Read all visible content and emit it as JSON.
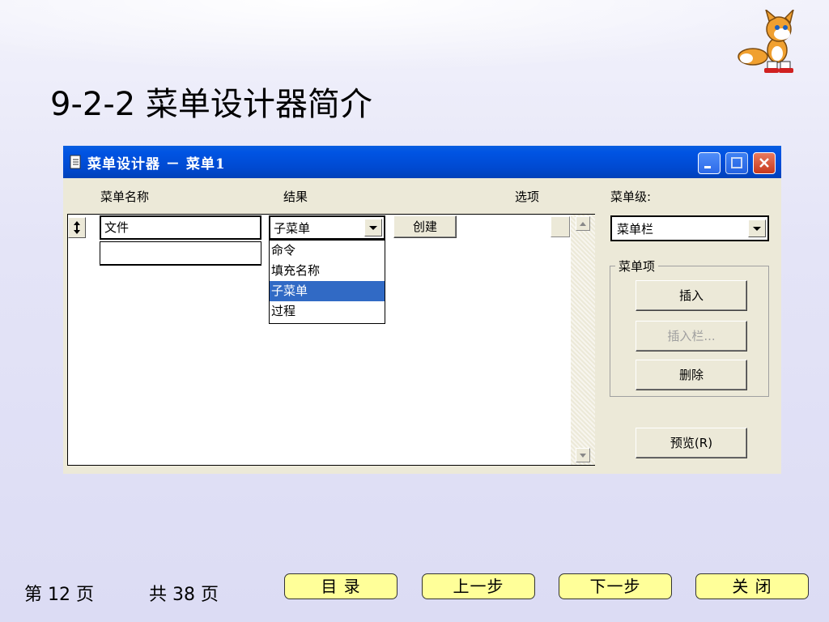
{
  "slide": {
    "title": "9-2-2 菜单设计器简介"
  },
  "dialog": {
    "title": "菜单设计器 － 菜单1",
    "columns": {
      "name": "菜单名称",
      "result": "结果",
      "options": "选项",
      "level": "菜单级:"
    },
    "rows": [
      {
        "name": "文件"
      },
      {
        "name": ""
      }
    ],
    "result_combo": {
      "value": "子菜单"
    },
    "result_options": [
      "命令",
      "填充名称",
      "子菜单",
      "过程"
    ],
    "create_button": "创建",
    "level_combo": {
      "value": "菜单栏"
    },
    "menu_item_group": "菜单项",
    "buttons": {
      "insert": "插入",
      "insert_bar": "插入栏...",
      "delete": "删除",
      "preview": "预览(R)"
    }
  },
  "footer": {
    "page_prefix": "第",
    "page_number": "12",
    "page_suffix": "页",
    "total_prefix": "共",
    "total_number": "38",
    "total_suffix": "页",
    "nav": {
      "toc": "目 录",
      "prev": "上一步",
      "next": "下一步",
      "close": "关 闭"
    }
  }
}
